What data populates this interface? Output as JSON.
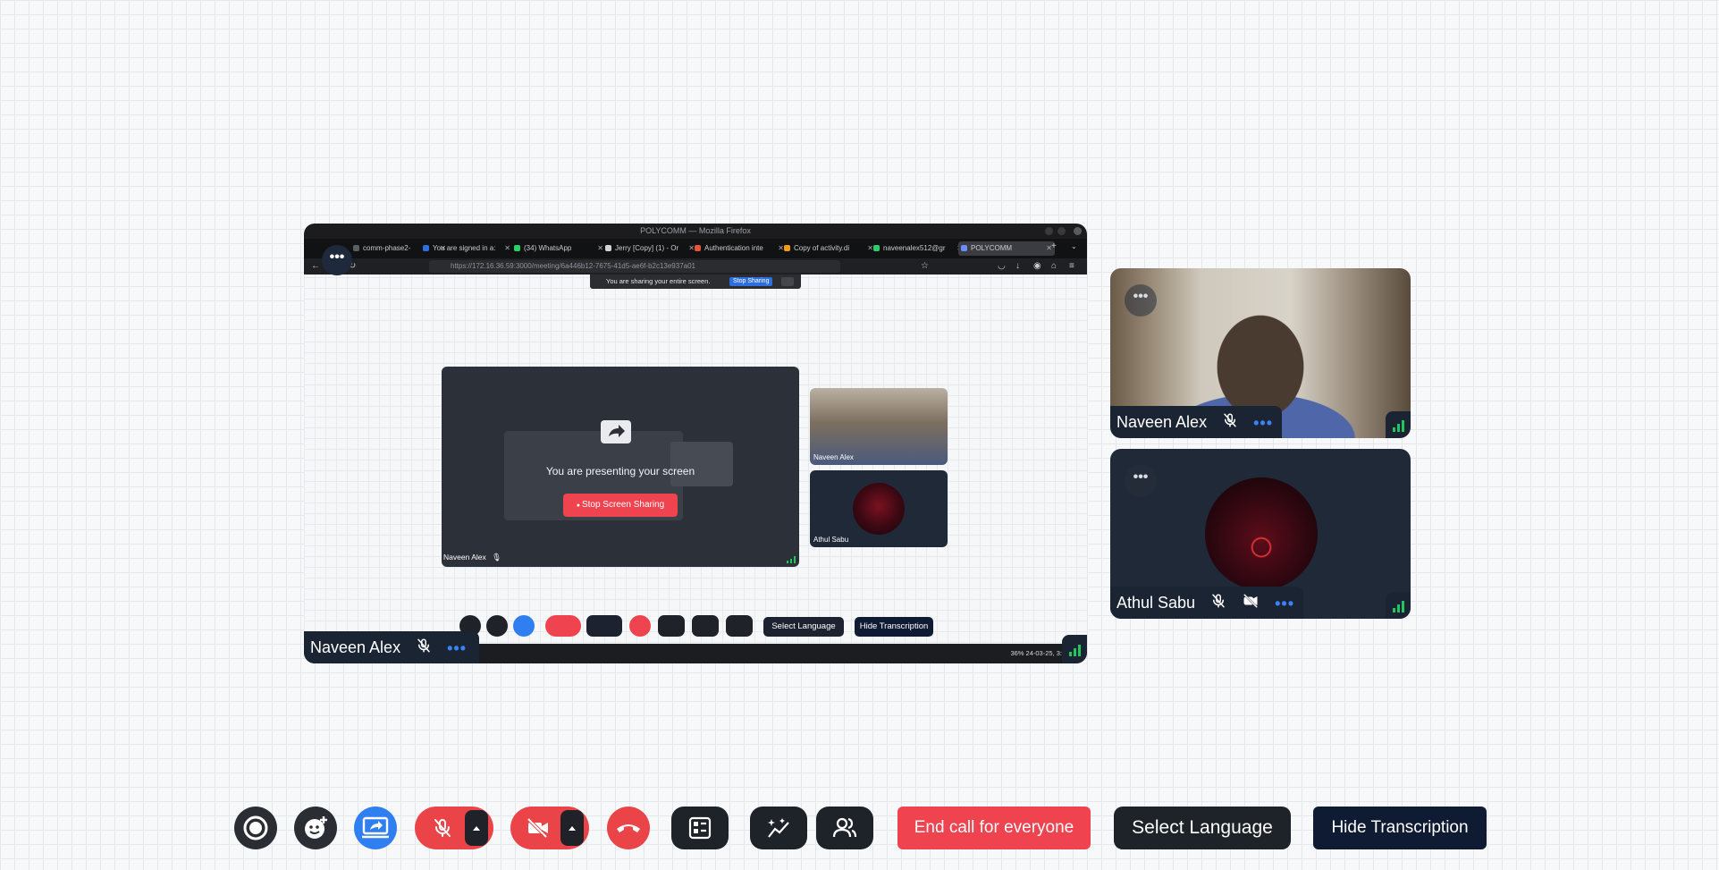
{
  "share": {
    "browser_title": "POLYCOMM — Mozilla Firefox",
    "tabs": [
      {
        "label": "comm-phase2-",
        "color": "#5a5f66"
      },
      {
        "label": "You are signed in a:",
        "color": "#2f6fdd"
      },
      {
        "label": "(34) WhatsApp",
        "color": "#25d366"
      },
      {
        "label": "Jerry [Copy] (1) - Or",
        "color": "#d0d3d7"
      },
      {
        "label": "Authentication inte",
        "color": "#e5533d"
      },
      {
        "label": "Copy of activity.di",
        "color": "#f39c12"
      },
      {
        "label": "naveenalex512@gr",
        "color": "#2ecc71"
      },
      {
        "label": "POLYCOMM",
        "color": "#6c8cff"
      }
    ],
    "url": "https://172.16.36.59:3000/meeting/6a446b12-7675-41d5-ae6f-b2c13e937a01",
    "notice_text": "You are sharing your entire screen.",
    "notice_stop": "Stop Sharing",
    "presenting_text": "You are presenting your screen",
    "stop_screen_sharing": "Stop Screen Sharing",
    "inner_presenter_name": "Naveen Alex",
    "inner_tiles": [
      {
        "name": "Naveen Alex"
      },
      {
        "name": "Athul Sabu"
      }
    ],
    "inner_toolbar": {
      "select_language": "Select Language",
      "hide_transcription": "Hide Transcription"
    },
    "taskbar_tray": "36%   24-03-25, 3:",
    "presenter_label": "Naveen Alex",
    "more_glyph": "•••"
  },
  "tiles": [
    {
      "name": "Naveen Alex",
      "mic_muted": true,
      "camera_off": false
    },
    {
      "name": "Athul Sabu",
      "mic_muted": true,
      "camera_off": true
    }
  ],
  "tile_more_glyph": "•••",
  "tile_menu_glyph": "•••",
  "toolbar": {
    "record_icon": "record-icon",
    "reaction_icon": "emoji-add-icon",
    "share_icon": "screen-share-icon",
    "mic_icon": "mic-off-icon",
    "camera_icon": "camera-off-icon",
    "leave_icon": "phone-hangup-icon",
    "whiteboard_icon": "list-layout-icon",
    "effects_icon": "sparkle-chart-icon",
    "participants_icon": "participants-icon",
    "end_call_label": "End call for everyone",
    "select_language_label": "Select Language",
    "hide_transcription_label": "Hide Transcription"
  },
  "colors": {
    "accent_blue": "#2f7ff0",
    "danger_red": "#ef4350",
    "tile_bg": "#1f2937",
    "label_bg": "#1b2433",
    "signal_green": "#22c55e"
  }
}
